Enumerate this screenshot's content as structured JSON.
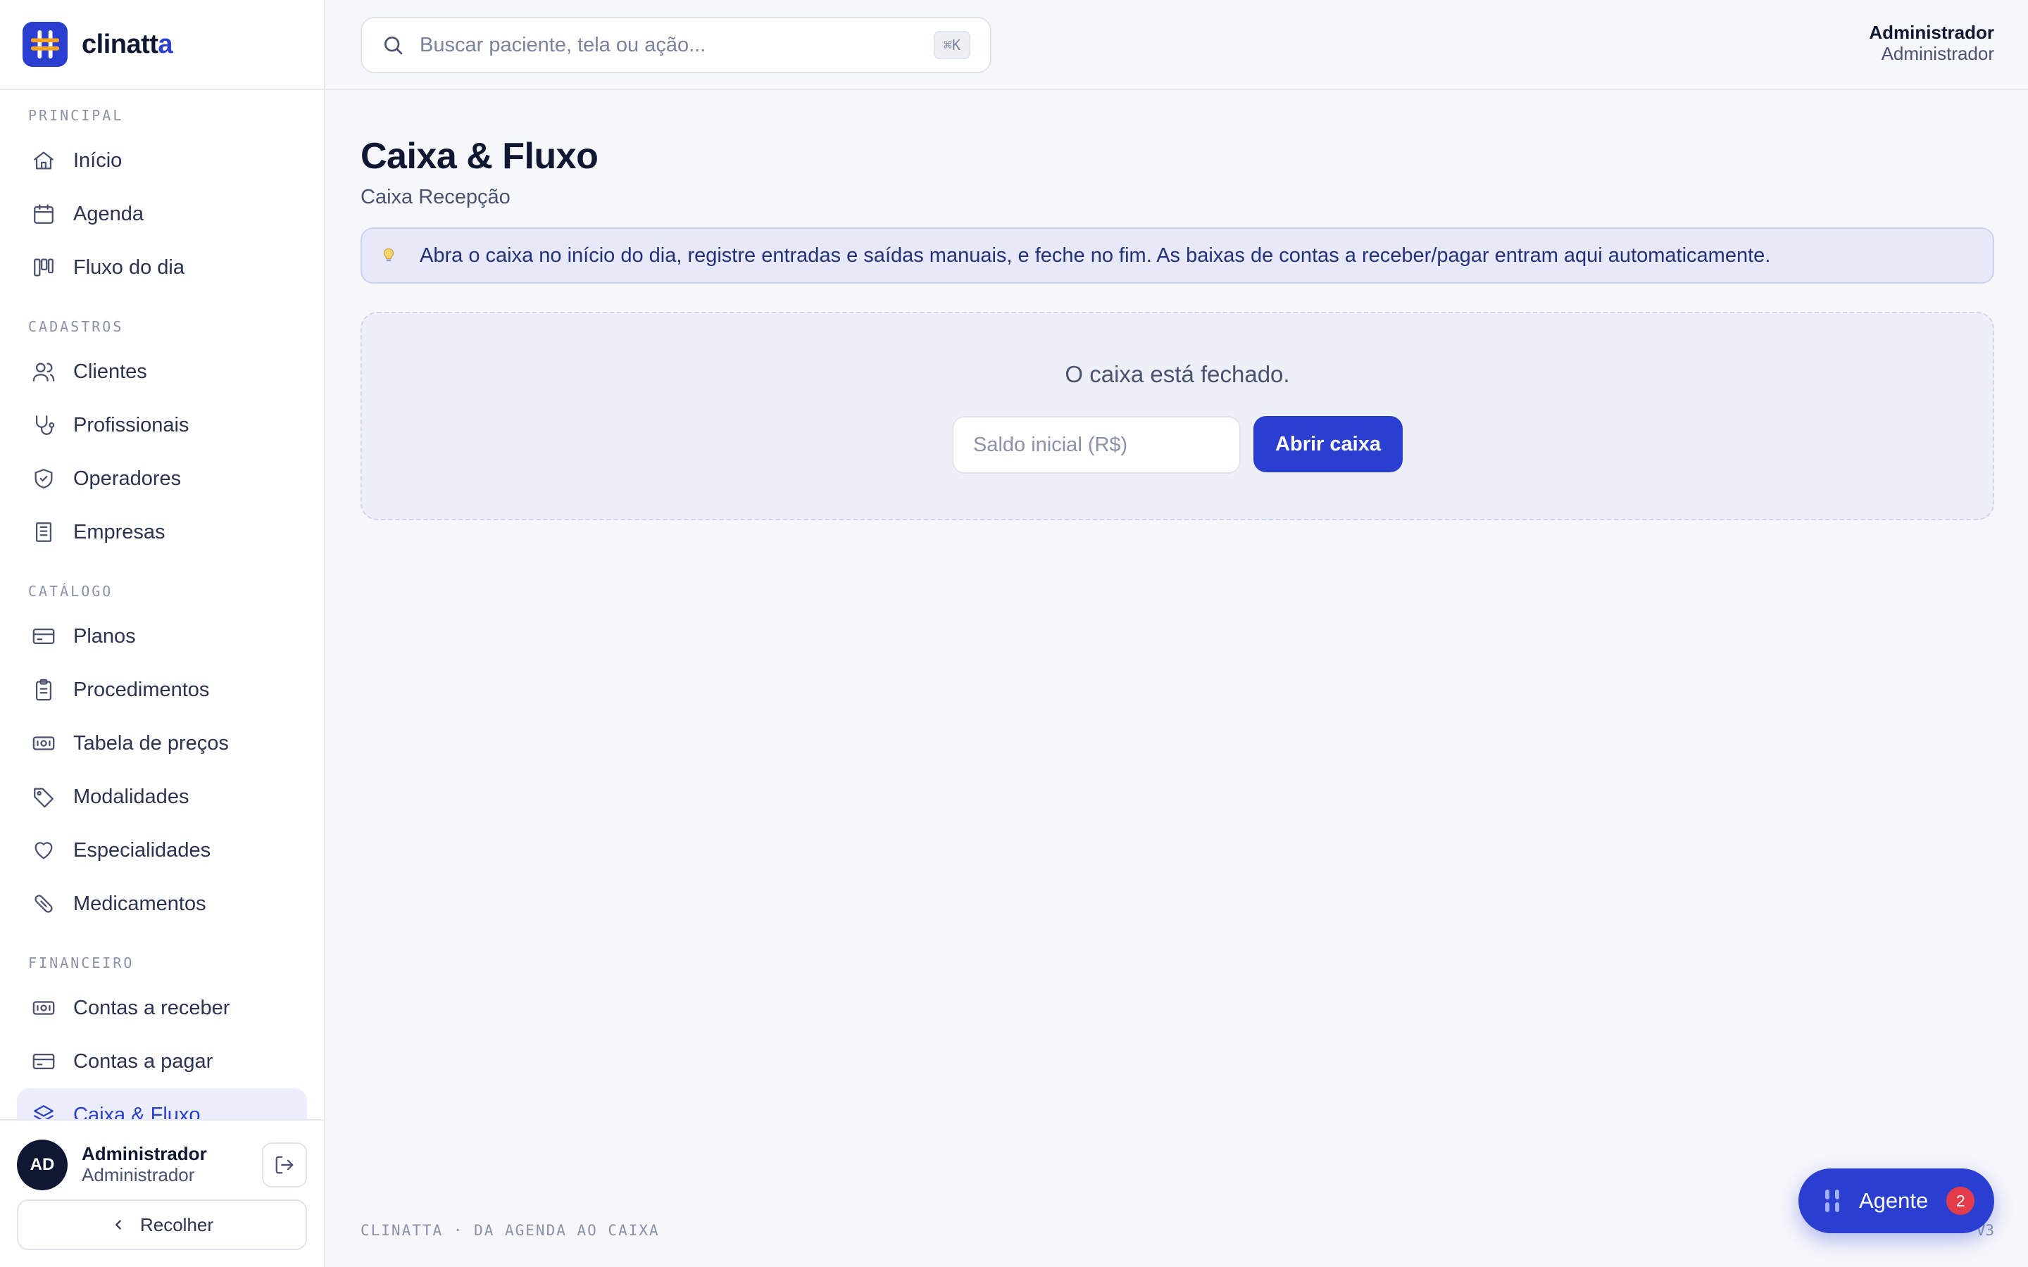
{
  "brand": {
    "name_main": "clinatt",
    "name_accent": "a"
  },
  "search": {
    "placeholder": "Buscar paciente, tela ou ação...",
    "shortcut": "⌘K"
  },
  "topbar": {
    "user_name": "Administrador",
    "user_role": "Administrador"
  },
  "sidebar": {
    "sections": [
      {
        "title": "PRINCIPAL",
        "items": [
          {
            "label": "Início",
            "icon": "home-icon"
          },
          {
            "label": "Agenda",
            "icon": "calendar-icon"
          },
          {
            "label": "Fluxo do dia",
            "icon": "kanban-icon"
          }
        ]
      },
      {
        "title": "CADASTROS",
        "items": [
          {
            "label": "Clientes",
            "icon": "users-icon"
          },
          {
            "label": "Profissionais",
            "icon": "stethoscope-icon"
          },
          {
            "label": "Operadores",
            "icon": "shield-icon"
          },
          {
            "label": "Empresas",
            "icon": "building-icon"
          }
        ]
      },
      {
        "title": "CATÁLOGO",
        "items": [
          {
            "label": "Planos",
            "icon": "credit-card-icon"
          },
          {
            "label": "Procedimentos",
            "icon": "clipboard-icon"
          },
          {
            "label": "Tabela de preços",
            "icon": "banknote-icon"
          },
          {
            "label": "Modalidades",
            "icon": "tag-icon"
          },
          {
            "label": "Especialidades",
            "icon": "heart-icon"
          },
          {
            "label": "Medicamentos",
            "icon": "pill-icon"
          }
        ]
      },
      {
        "title": "FINANCEIRO",
        "items": [
          {
            "label": "Contas a receber",
            "icon": "banknote-icon"
          },
          {
            "label": "Contas a pagar",
            "icon": "credit-card-icon"
          },
          {
            "label": "Caixa & Fluxo",
            "icon": "layers-icon",
            "active": true
          }
        ]
      }
    ],
    "footer": {
      "avatar_initials": "AD",
      "user_name": "Administrador",
      "user_role": "Administrador",
      "collapse_label": "Recolher"
    }
  },
  "main": {
    "title": "Caixa & Fluxo",
    "subtitle": "Caixa Recepção",
    "tip": "Abra o caixa no início do dia, registre entradas e saídas manuais, e feche no fim. As baixas de contas a receber/pagar entram aqui automaticamente.",
    "closed_message": "O caixa está fechado.",
    "saldo_placeholder": "Saldo inicial (R$)",
    "open_button": "Abrir caixa"
  },
  "footer": {
    "left": "CLINATTA · DA AGENDA AO CAIXA",
    "right": "V3"
  },
  "agent": {
    "label": "Agente",
    "badge": "2"
  },
  "colors": {
    "accent": "#2a3fcf",
    "badge": "#e23b4a",
    "tip_bg": "#e7e9f8"
  }
}
